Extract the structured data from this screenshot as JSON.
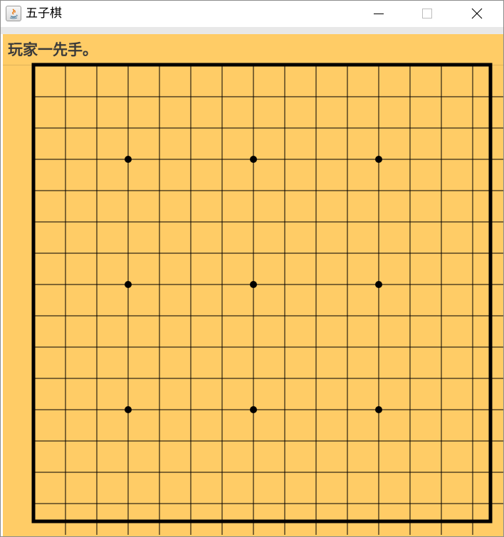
{
  "window": {
    "title": "五子棋",
    "icon": "java-app-icon",
    "controls": [
      "minimize-icon",
      "maximize-icon",
      "close-icon"
    ]
  },
  "status": {
    "text": "玩家一先手。"
  },
  "board": {
    "grid_lines": 15,
    "star_points": [
      [
        3,
        3
      ],
      [
        7,
        3
      ],
      [
        11,
        3
      ],
      [
        3,
        7
      ],
      [
        7,
        7
      ],
      [
        11,
        7
      ],
      [
        3,
        11
      ],
      [
        7,
        11
      ],
      [
        11,
        11
      ]
    ],
    "stones": [],
    "colors": {
      "background": "#ffcc66",
      "lines": "#000000",
      "border": "#000000",
      "star": "#000000"
    }
  }
}
